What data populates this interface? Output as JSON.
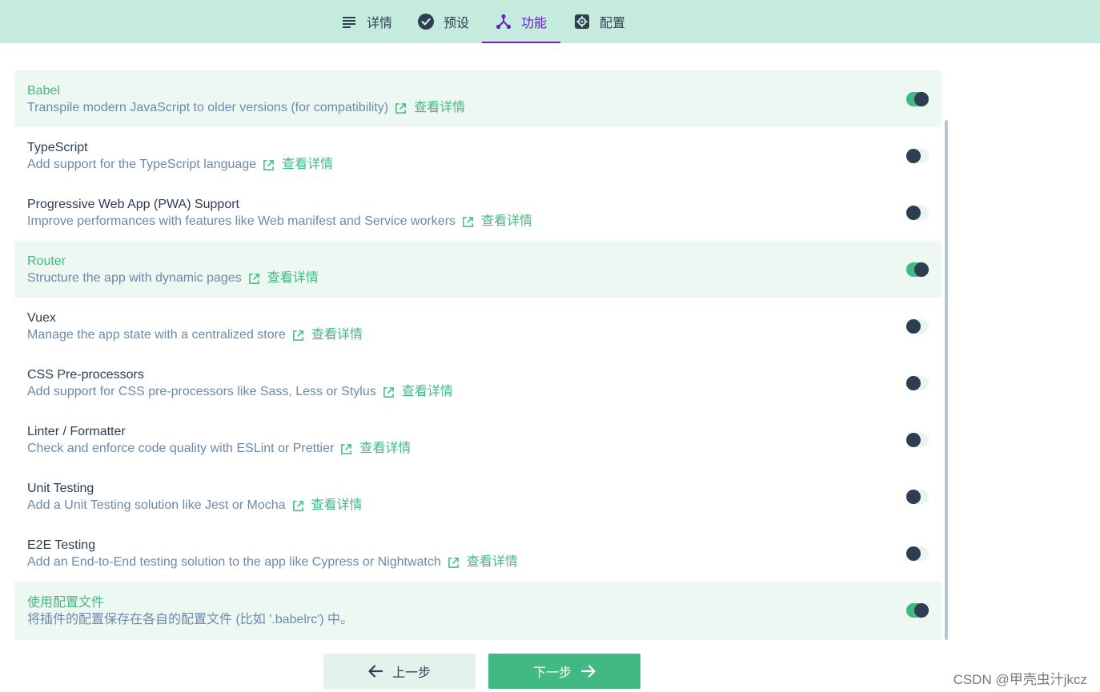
{
  "tabs": [
    {
      "label": "详情",
      "icon": "list-icon"
    },
    {
      "label": "预设",
      "icon": "check-circle-icon"
    },
    {
      "label": "功能",
      "icon": "fork-icon",
      "active": true
    },
    {
      "label": "配置",
      "icon": "gear-icon"
    }
  ],
  "features": [
    {
      "name": "Babel",
      "desc": "Transpile modern JavaScript to older versions (for compatibility)",
      "link": "查看详情",
      "enabled": true
    },
    {
      "name": "TypeScript",
      "desc": "Add support for the TypeScript language",
      "link": "查看详情",
      "enabled": false
    },
    {
      "name": "Progressive Web App (PWA) Support",
      "desc": "Improve performances with features like Web manifest and Service workers",
      "link": "查看详情",
      "enabled": false
    },
    {
      "name": "Router",
      "desc": "Structure the app with dynamic pages",
      "link": "查看详情",
      "enabled": true
    },
    {
      "name": "Vuex",
      "desc": "Manage the app state with a centralized store",
      "link": "查看详情",
      "enabled": false
    },
    {
      "name": "CSS Pre-processors",
      "desc": "Add support for CSS pre-processors like Sass, Less or Stylus",
      "link": "查看详情",
      "enabled": false
    },
    {
      "name": "Linter / Formatter",
      "desc": "Check and enforce code quality with ESLint or Prettier",
      "link": "查看详情",
      "enabled": false
    },
    {
      "name": "Unit Testing",
      "desc": "Add a Unit Testing solution like Jest or Mocha",
      "link": "查看详情",
      "enabled": false
    },
    {
      "name": "E2E Testing",
      "desc": "Add an End-to-End testing solution to the app like Cypress or Nightwatch",
      "link": "查看详情",
      "enabled": false
    }
  ],
  "config_file": {
    "name": "使用配置文件",
    "desc": "将插件的配置保存在各自的配置文件 (比如 '.babelrc') 中。",
    "enabled": true
  },
  "buttons": {
    "prev_label": "上一步",
    "next_label": "下一步"
  },
  "watermark": "CSDN @甲壳虫汁jkcz",
  "colors": {
    "accent": "#42b983",
    "tab_active": "#6a1fc7",
    "tabbar_bg": "#c4ebdd",
    "text": "#2c3e50",
    "desc": "#6b8aa8"
  }
}
